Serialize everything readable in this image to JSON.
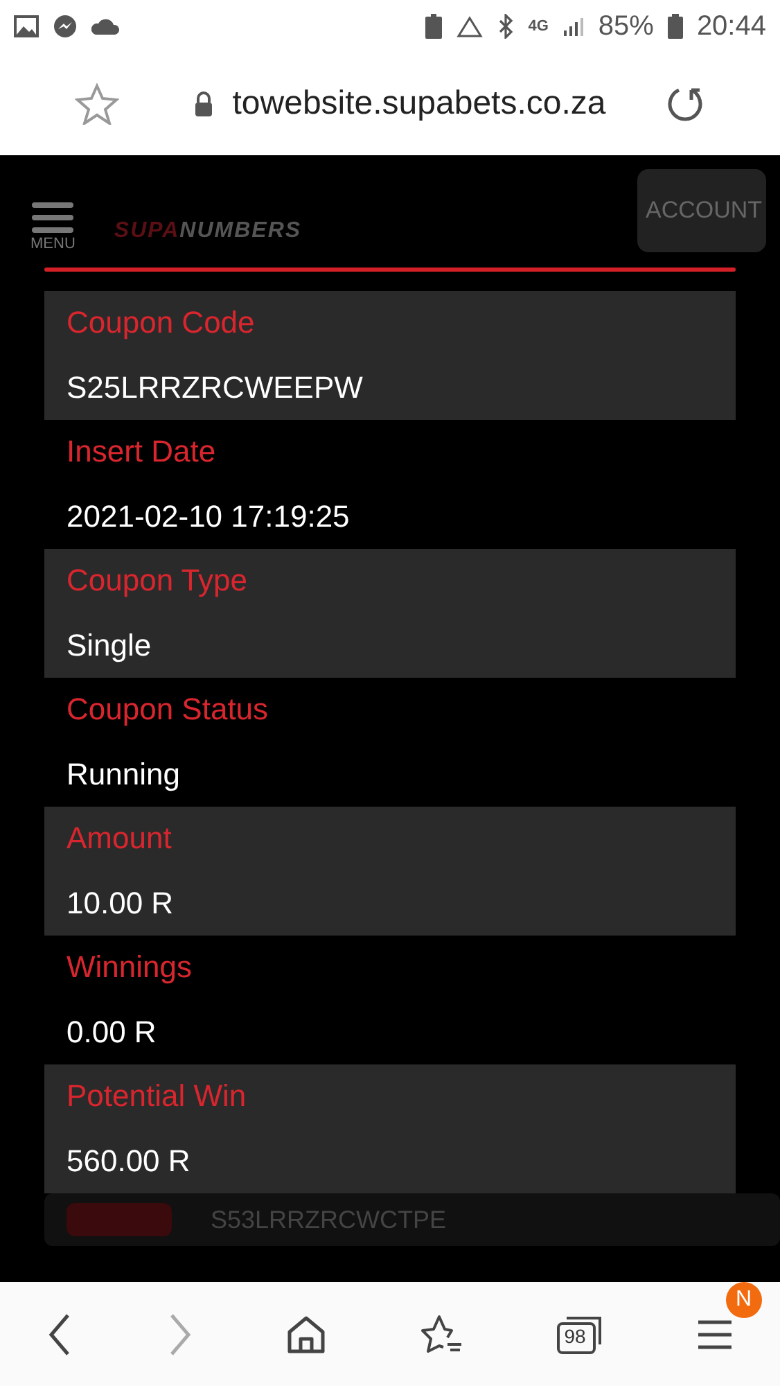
{
  "status_bar": {
    "network": "4G",
    "battery": "85%",
    "time": "20:44"
  },
  "browser": {
    "url": "towebsite.supabets.co.za",
    "tab_count": "98",
    "badge": "N"
  },
  "header": {
    "menu_label": "MENU",
    "logo": {
      "first": "SUPA",
      "second": "NUMBERS"
    },
    "account_button": "ACCOUNT"
  },
  "details": [
    {
      "label": "Coupon Code",
      "value": "S25LRRZRCWEEPW"
    },
    {
      "label": "Insert Date",
      "value": "2021-02-10 17:19:25"
    },
    {
      "label": "Coupon Type",
      "value": "Single"
    },
    {
      "label": "Coupon Status",
      "value": "Running"
    },
    {
      "label": "Amount",
      "value": "10.00 R"
    },
    {
      "label": "Winnings",
      "value": "0.00 R"
    },
    {
      "label": "Potential Win",
      "value": "560.00 R"
    }
  ],
  "background_coupon": {
    "code": "S53LRRZRCWCTPE"
  }
}
